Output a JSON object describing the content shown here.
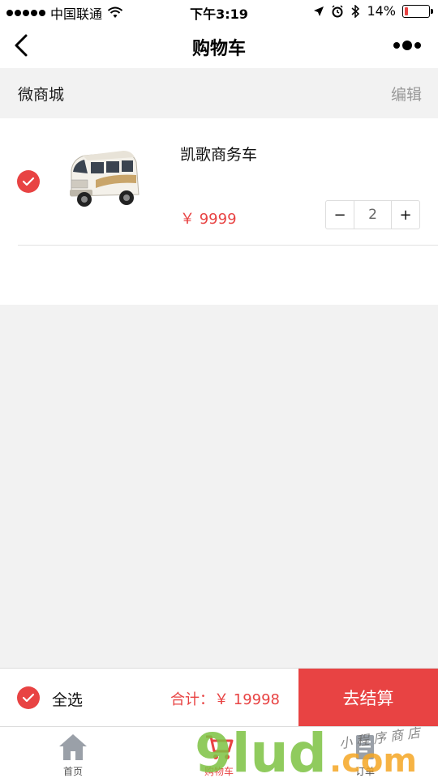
{
  "status_bar": {
    "carrier": "中国联通",
    "time": "下午3:19",
    "battery": "14%",
    "battery_level": 0.14
  },
  "nav": {
    "title": "购物车",
    "back_icon": "chevron-left-icon",
    "more_icon": "more-dots-icon"
  },
  "shop": {
    "name": "微商城",
    "edit_label": "编辑"
  },
  "cart": {
    "items": [
      {
        "name": "凯歌商务车",
        "price": "￥ 9999",
        "quantity": "2",
        "minus_label": "−",
        "plus_label": "+",
        "checked": true
      }
    ]
  },
  "checkout": {
    "select_all_label": "全选",
    "total_label": "合计：￥ 19998",
    "checkout_label": "去结算"
  },
  "tabs": [
    {
      "label": "首页",
      "icon": "home-icon",
      "active": false
    },
    {
      "label": "购物车",
      "icon": "cart-icon",
      "active": true
    },
    {
      "label": "订单",
      "icon": "order-icon",
      "active": false
    }
  ],
  "watermark": {
    "brand": "9lud",
    "suffix": ".com",
    "tagline": "小程序商店"
  },
  "colors": {
    "accent": "#e84343",
    "background": "#f2f2f2",
    "muted": "#999999"
  }
}
